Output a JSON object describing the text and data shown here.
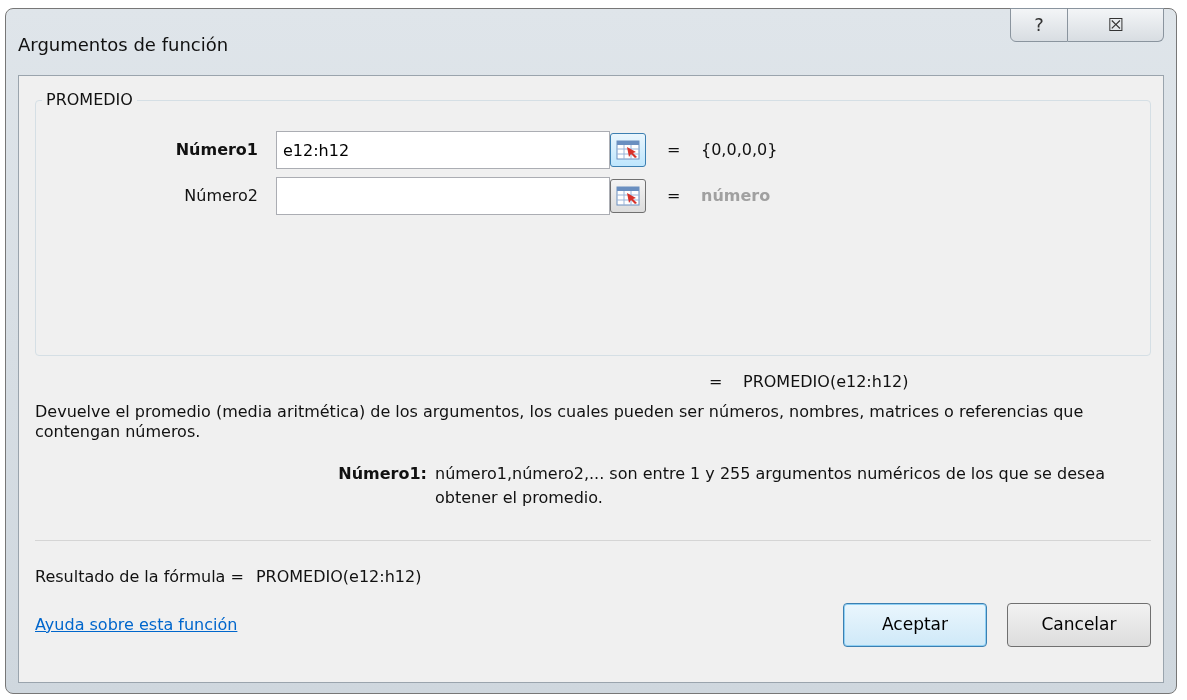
{
  "window": {
    "title": "Argumentos de función",
    "help_button": "?",
    "close_button": "☒"
  },
  "group": {
    "title": "PROMEDIO",
    "arguments": [
      {
        "label": "Número1",
        "selected": true,
        "value": "e12:h12",
        "equals": "=",
        "kind": "value",
        "result": "{0,0,0,0}"
      },
      {
        "label": "Número2",
        "selected": false,
        "equals": "=",
        "kind": "hint",
        "result": "número"
      }
    ]
  },
  "overall_result": {
    "equals": "=",
    "value": "PROMEDIO(e12:h12)"
  },
  "description": "Devuelve el promedio (media aritmética) de los argumentos, los cuales pueden ser números, nombres, matrices o referencias que contengan números.",
  "argument_help": {
    "label": "Número1:",
    "text": "número1,número2,... son entre 1 y 255 argumentos numéricos de los que se desea obtener el promedio."
  },
  "formula_result": {
    "label": "Resultado de la fórmula =",
    "value": "PROMEDIO(e12:h12)"
  },
  "help_link": "Ayuda sobre esta función",
  "buttons": [
    {
      "label": "Aceptar",
      "default": true
    },
    {
      "label": "Cancelar",
      "default": false
    }
  ]
}
